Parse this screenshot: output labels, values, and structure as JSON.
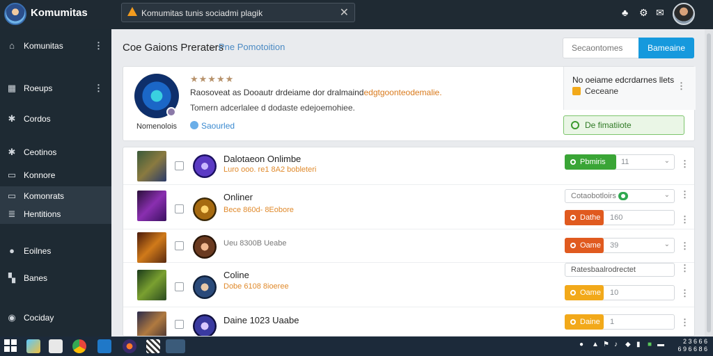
{
  "app": {
    "title": "Komumitas"
  },
  "notification": {
    "text": "Komumitas tunis sociadmi plagik"
  },
  "sidebar": {
    "items": [
      {
        "label": "Komunitas",
        "icon": "home-icon",
        "dots": true
      },
      {
        "label": "Roeups",
        "icon": "grid-icon",
        "dots": true
      },
      {
        "label": "Cordos",
        "icon": "puzzle-icon",
        "dots": false
      },
      {
        "label": "Ceotinos",
        "icon": "puzzle-icon",
        "dots": false
      },
      {
        "label": "Konnore",
        "icon": "card-icon",
        "dots": false
      },
      {
        "label": "Komonrats",
        "icon": "card-icon",
        "dots": false
      },
      {
        "label": "Hentitions",
        "icon": "list-icon",
        "dots": false
      },
      {
        "label": "Eoilnes",
        "icon": "gamepad-icon",
        "dots": false
      },
      {
        "label": "Banes",
        "icon": "blocks-icon",
        "dots": false
      },
      {
        "label": "Cociday",
        "icon": "compass-icon",
        "dots": false
      }
    ]
  },
  "breadcrumb": {
    "first": "Coe Gaions Preraters",
    "sep": ">",
    "second": "Pne Pomotoition"
  },
  "search": {
    "placeholder": "Secaontomes",
    "button": "Bameaine"
  },
  "featured": {
    "name": "Nomenolois",
    "stars": "★★★★★",
    "desc1_main": "Raosoveat as Dooautr drdeiame dor dralmaind",
    "desc1_highlight": "edgtgoonteodemalie.",
    "desc2": "Tomern adcerlalee d dodaste edejoemohiee.",
    "tag": "Saourled",
    "side_title": "No oeiame edcrdarnes llets",
    "side_sub": "Ceceane",
    "cta": "De fimatiiote"
  },
  "rows": [
    {
      "title": "Dalotaeon Onlimbe",
      "sub": "Luro ooo. re1 8A2 bobleteri",
      "sub_color": "orange",
      "ctl": {
        "kind": "pill",
        "label": "Pbmiris",
        "color": "#3aa536",
        "count": "11",
        "caret": true
      }
    },
    {
      "title": "Onliner",
      "sub": "Bece 860d- 8Eobore",
      "sub_color": "orange",
      "ctl": {
        "kind": "toggle",
        "label": "Cotaobotloirs",
        "caret": true
      }
    },
    {
      "title": "",
      "sub": "Ueu 8300B Ueabe",
      "sub_color": "gray",
      "ctl": {
        "kind": "pill",
        "label": "Dathe",
        "color": "#e05a1f",
        "count": "160",
        "caret": false
      }
    },
    {
      "title": "",
      "sub": "Ueu 8300B Ueabo",
      "sub_color": "gray",
      "ctl": {
        "kind": "pill",
        "label": "Oame",
        "color": "#e05a1f",
        "count": "39",
        "caret": true
      }
    },
    {
      "title": "Coline",
      "sub": "Dobe 6108 8ioeree",
      "sub_color": "orange",
      "ctl": {
        "kind": "plain",
        "label": "Ratesbaalrodrectet",
        "caret": false
      }
    },
    {
      "title": "",
      "sub": "",
      "sub_color": "gray",
      "ctl": {
        "kind": "pill",
        "label": "Oame",
        "color": "#f2a91a",
        "count": "10",
        "caret": false
      }
    },
    {
      "title": "Daine 1023 Uaabe",
      "sub": "",
      "sub_color": "gray",
      "ctl": {
        "kind": "pill",
        "label": "Daine",
        "color": "#f2a91a",
        "count": "1",
        "caret": false
      }
    }
  ],
  "taskbar": {
    "clock_time": "2 3 6 6 6",
    "clock_date": "6 9 6 6 8 6"
  }
}
